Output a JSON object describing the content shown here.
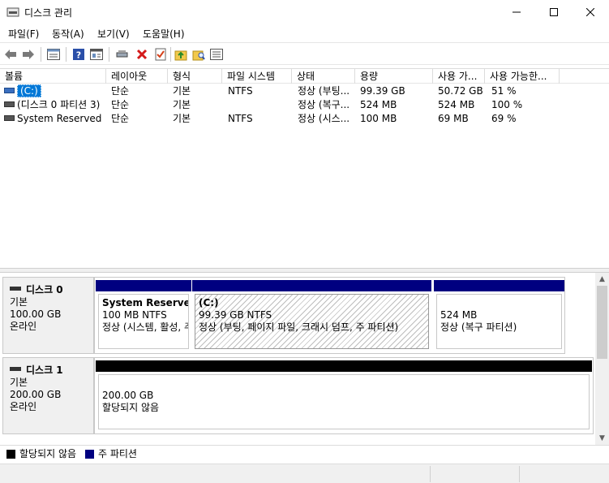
{
  "window": {
    "title": "디스크 관리",
    "minimize_glyph": "—",
    "maximize_glyph": "☐",
    "close_glyph": "✕"
  },
  "menu": [
    "파일(F)",
    "동작(A)",
    "보기(V)",
    "도움말(H)"
  ],
  "toolbar": {
    "icons": [
      "back-arrow-icon",
      "forward-arrow-icon",
      "list-view-icon",
      "help-icon",
      "properties-icon",
      "connect-icon",
      "delete-icon",
      "checkmark-icon",
      "up-folder-icon",
      "search-folder-icon",
      "disk-list-icon"
    ]
  },
  "volume_table": {
    "headers": [
      "볼륨",
      "레이아웃",
      "형식",
      "파일 시스템",
      "상태",
      "용량",
      "사용 가...",
      "사용 가능한..."
    ],
    "rows": [
      [
        "(C:)",
        "단순",
        "기본",
        "NTFS",
        "정상 (부팅...",
        "99.39 GB",
        "50.72 GB",
        "51 %"
      ],
      [
        "(디스크 0 파티션 3)",
        "단순",
        "기본",
        "",
        "정상 (복구...",
        "524 MB",
        "524 MB",
        "100 %"
      ],
      [
        "System Reserved",
        "단순",
        "기본",
        "NTFS",
        "정상 (시스...",
        "100 MB",
        "69 MB",
        "69 %"
      ]
    ],
    "selected_row": 0
  },
  "disks": [
    {
      "name": "디스크 0",
      "type": "기본",
      "size": "100.00 GB",
      "status": "온라인",
      "partitions": [
        {
          "name": "System Reserved",
          "size_fs": "100 MB NTFS",
          "status": "정상 (시스템, 활성, 주 파티션)",
          "color": "#000080"
        },
        {
          "name": "(C:)",
          "size_fs": "99.39 GB NTFS",
          "status": "정상 (부팅, 페이지 파일, 크래시 덤프, 주 파티션)",
          "color": "#000080"
        },
        {
          "name": "",
          "size_fs": "524 MB",
          "status": "정상 (복구 파티션)",
          "color": "#000080"
        }
      ]
    },
    {
      "name": "디스크 1",
      "type": "기본",
      "size": "200.00 GB",
      "status": "온라인",
      "partitions": [
        {
          "name": "",
          "size_fs": "200.00 GB",
          "status": "할당되지 않음",
          "color": "#000000"
        }
      ]
    }
  ],
  "legend": [
    {
      "label": "할당되지 않음",
      "color": "#000000"
    },
    {
      "label": "주 파티션",
      "color": "#000080"
    }
  ]
}
